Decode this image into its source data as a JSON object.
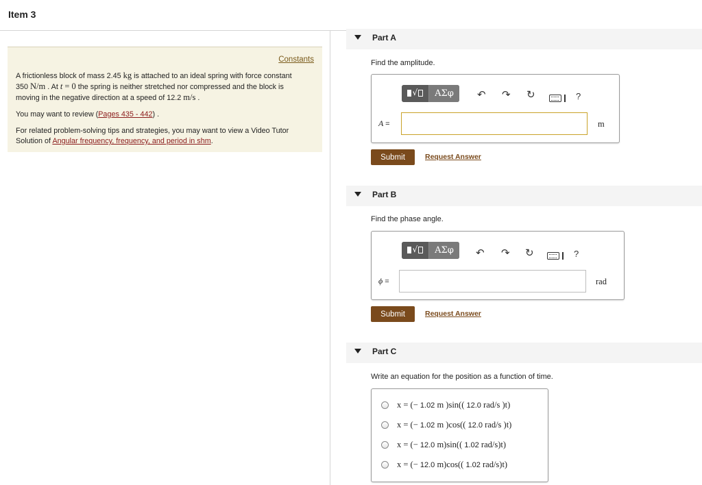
{
  "header": {
    "title": "Item 3"
  },
  "problem": {
    "constants_link": "Constants",
    "p1_a": "A frictionless block of mass 2.45",
    "p1_kg": "kg",
    "p1_b": "is attached to an ideal spring with force constant",
    "p1_c": "350",
    "p1_unit": "N/m",
    "p1_d": ". At",
    "p1_t": "t",
    "p1_eq": "= 0",
    "p1_e": "the spring is neither stretched nor compressed and the block is",
    "p1_f": "moving in the negative direction at a speed of 12.2",
    "p1_speed_unit": "m/s",
    "p1_g": ".",
    "p2_a": "You may want to review (",
    "p2_link": "Pages 435 - 442",
    "p2_b": ") .",
    "p3_a": "For related problem-solving tips and strategies, you may want to view a Video Tutor",
    "p3_b": "Solution of",
    "p3_link": "Angular frequency, frequency, and period in shm",
    "p3_c": "."
  },
  "toolbar": {
    "greek_label": "ΑΣφ",
    "undo_icon": "↶",
    "redo_icon": "↷",
    "reset_icon": "↻",
    "help_label": "?"
  },
  "parts": [
    {
      "label": "Part A",
      "prompt": "Find the amplitude.",
      "var": "A",
      "eq": "=",
      "unit": "m",
      "submit": "Submit",
      "request": "Request Answer"
    },
    {
      "label": "Part B",
      "prompt": "Find the phase angle.",
      "var": "ϕ",
      "eq": "=",
      "unit": "rad",
      "submit": "Submit",
      "request": "Request Answer"
    },
    {
      "label": "Part C",
      "prompt": "Write an equation for the position as a function of time.",
      "options": [
        {
          "pre": "x = (− ",
          "num1": "1.02",
          "u1": " m )sin(( ",
          "num2": "12.0",
          "u2": " rad/s )t)"
        },
        {
          "pre": "x = (− ",
          "num1": "1.02",
          "u1": " m )cos(( ",
          "num2": "12.0",
          "u2": " rad/s )t)"
        },
        {
          "pre": "x = (− ",
          "num1": "12.0",
          "u1": " m)sin(( ",
          "num2": "1.02",
          "u2": " rad/s)t)"
        },
        {
          "pre": "x = (− ",
          "num1": "12.0",
          "u1": " m)cos(( ",
          "num2": "1.02",
          "u2": " rad/s)t)"
        }
      ]
    }
  ]
}
